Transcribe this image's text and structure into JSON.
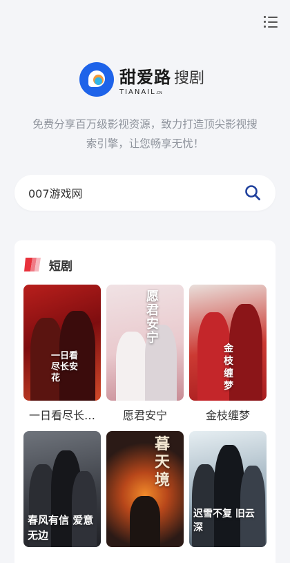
{
  "header": {
    "menu_icon": "list-menu-icon"
  },
  "logo": {
    "brand": "甜爱路",
    "suffix": "搜剧",
    "latin": "TIANAIL",
    "latin_small": ".CN"
  },
  "tagline": "免费分享百万级影视资源，致力打造顶尖影视搜索引擎，让您畅享无忧！",
  "search": {
    "value": "007游戏网",
    "icon": "search-icon"
  },
  "section": {
    "title": "短剧",
    "items": [
      {
        "title": "一日看尽长…",
        "poster_text": "一日看尽长安花"
      },
      {
        "title": "愿君安宁",
        "poster_text": "愿君安宁"
      },
      {
        "title": "金枝缠梦",
        "poster_text": "金枝缠梦"
      },
      {
        "title": "",
        "poster_text": "春风有信 爱意无边"
      },
      {
        "title": "",
        "poster_text": "暮天境"
      },
      {
        "title": "",
        "poster_text": "迟雪不复 旧云深"
      }
    ]
  },
  "colors": {
    "accent": "#1e63e9",
    "background": "#f4f5f8",
    "section_mark": "#e8313b"
  }
}
